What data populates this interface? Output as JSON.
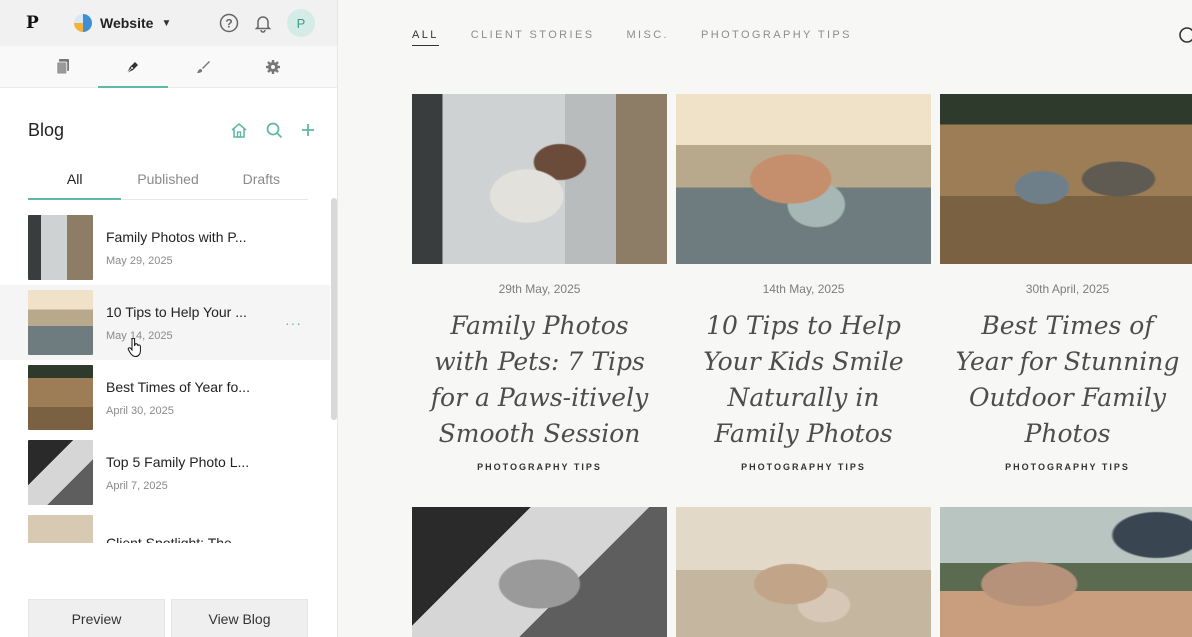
{
  "topbar": {
    "logo": "P",
    "site_label": "Website",
    "avatar_letter": "P"
  },
  "tool_tabs": [
    {
      "name": "pages",
      "icon": "pages-icon"
    },
    {
      "name": "blog",
      "icon": "pen-icon",
      "active": true
    },
    {
      "name": "design",
      "icon": "brush-icon"
    },
    {
      "name": "settings",
      "icon": "gear-icon"
    }
  ],
  "blog": {
    "title": "Blog",
    "filters": [
      "All",
      "Published",
      "Drafts"
    ],
    "active_filter": "All"
  },
  "posts": [
    {
      "title": "Family Photos with P...",
      "date": "May 29, 2025"
    },
    {
      "title": "10 Tips to Help Your ...",
      "date": "May 14, 2025"
    },
    {
      "title": "Best Times of Year fo...",
      "date": "April 30, 2025"
    },
    {
      "title": "Top 5 Family Photo L...",
      "date": "April 7, 2025"
    },
    {
      "title": "Client Spotlight: The",
      "date": ""
    }
  ],
  "more_glyph": "···",
  "buttons": {
    "preview": "Preview",
    "view_blog": "View Blog"
  },
  "main": {
    "categories": [
      "ALL",
      "CLIENT STORIES",
      "MISC.",
      "PHOTOGRAPHY TIPS"
    ],
    "active_category": "ALL",
    "cards": [
      {
        "date": "29th May, 2025",
        "title": "Family Photos with Pets: 7 Tips for a Paws-itively Smooth Session",
        "category": "PHOTOGRAPHY TIPS"
      },
      {
        "date": "14th May, 2025",
        "title": "10 Tips to Help Your Kids Smile Naturally in Family Photos",
        "category": "PHOTOGRAPHY TIPS"
      },
      {
        "date": "30th April, 2025",
        "title": "Best Times of Year for Stunning Outdoor Family Photos",
        "category": "PHOTOGRAPHY TIPS"
      }
    ]
  },
  "colors": {
    "accent": "#5fb9a5",
    "sidebar_bg": "#ffffff",
    "main_bg": "#f7f7f5"
  }
}
